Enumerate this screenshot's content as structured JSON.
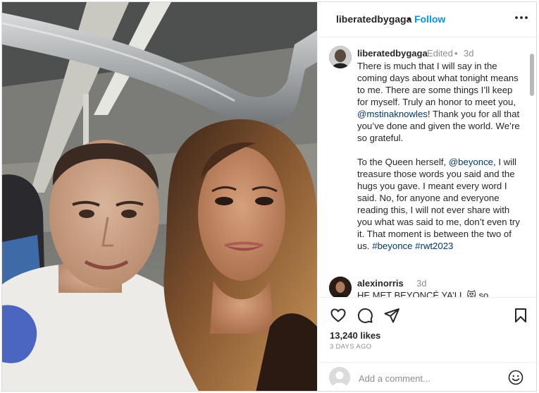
{
  "post": {
    "photo_alt": "Selfie of two people in a concrete garage with overhead ducts"
  },
  "header": {
    "username": "liberatedbygaga",
    "separator": "•",
    "follow_label": "Follow",
    "more_icon": "more-options-icon"
  },
  "caption": {
    "username": "liberatedbygaga",
    "edited_label": "Edited",
    "separator": "•",
    "time": "3d",
    "paragraph1_before": "There is much that I will say in the coming days about what tonight means to me. There are some things I’ll keep for myself. Truly an honor to meet you, ",
    "mention1": "@mstinaknowles",
    "paragraph1_after": "! Thank you for all that you’ve done and given the world. We’re so grateful.",
    "paragraph2_before": "To the Queen herself, ",
    "mention2": "@beyonce",
    "paragraph2_after": ", I will treasure those words you said and the hugs you gave. I meant every word I said. No, for anyone and everyone reading this, I will not ever share with you what was said to me, don’t even try it. That moment is between the two of us. ",
    "hashtag1": "#beyonce",
    "hashtag2": "#rwt2023"
  },
  "comment2": {
    "username": "alexinorris",
    "time": "3d",
    "text": "HE MET BEYONCÉ YA’LL 😻 so"
  },
  "actions": {
    "likes": "13,240 likes",
    "date": "3 DAYS AGO",
    "icons": [
      "heart-icon",
      "comment-icon",
      "share-icon",
      "bookmark-icon"
    ]
  },
  "add_comment": {
    "placeholder": "Add a comment...",
    "emoji_icon": "emoji-icon"
  },
  "colors": {
    "link_blue": "#0095f6",
    "mention_blue": "#00376b",
    "muted": "#8e8e8e",
    "text": "#262626"
  }
}
